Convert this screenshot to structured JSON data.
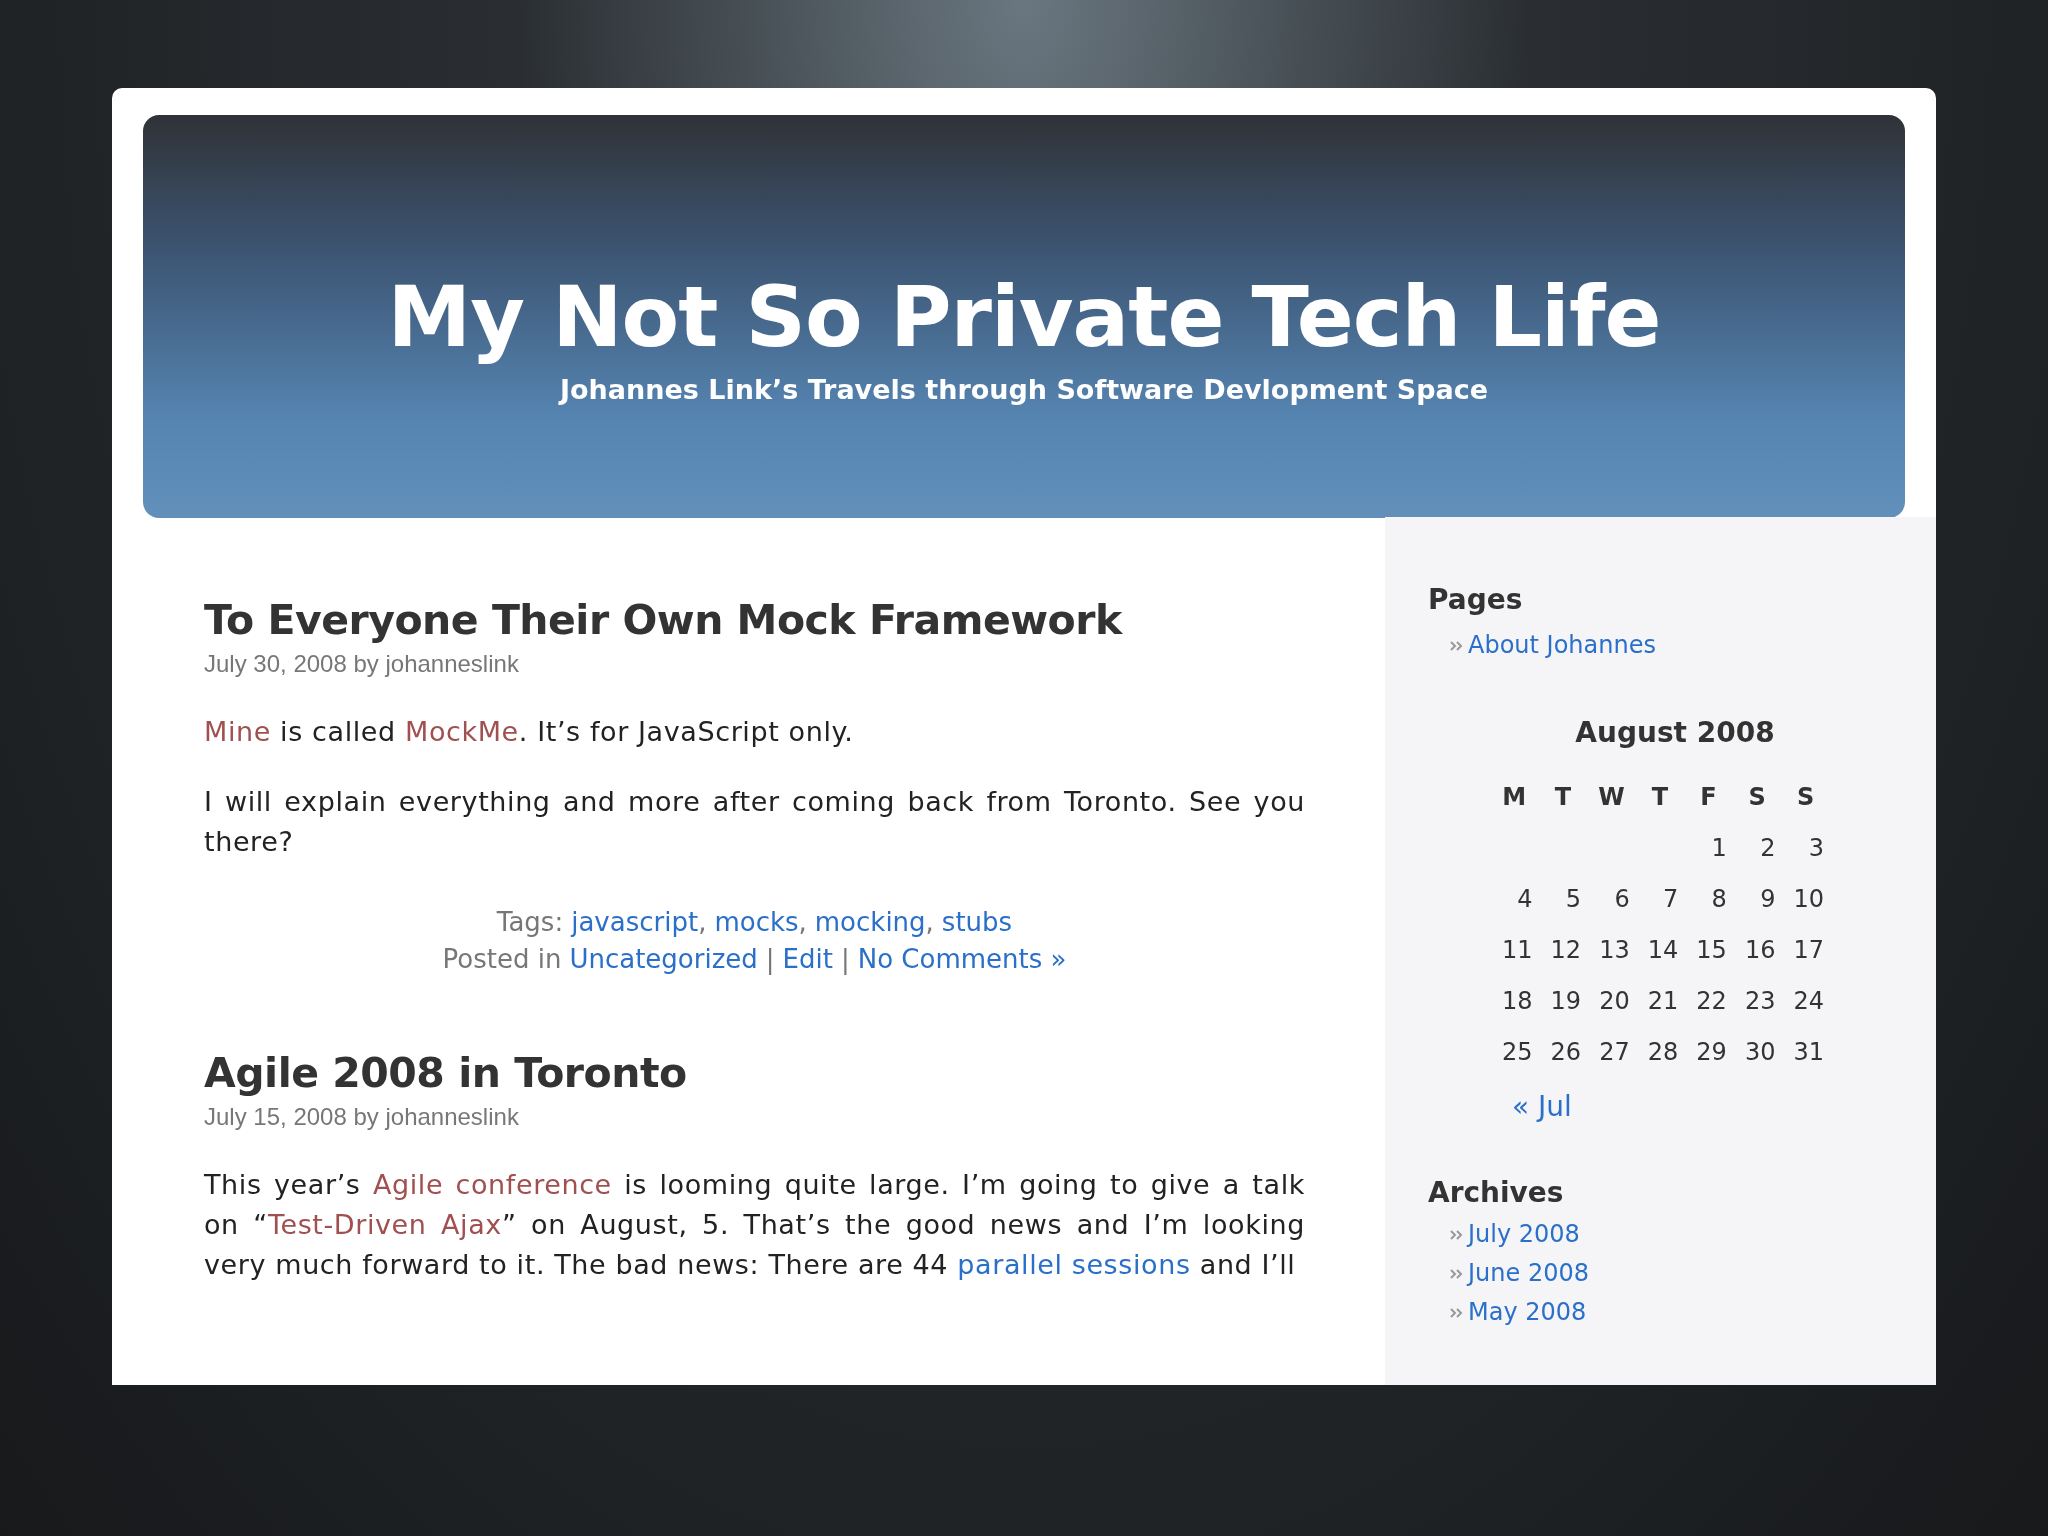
{
  "header": {
    "title": "My Not So Private Tech Life",
    "tagline": "Johannes Link’s Travels through Software Devlopment Space"
  },
  "posts": [
    {
      "title": "To Everyone Their Own Mock Framework",
      "meta": "July 30, 2008 by johanneslink",
      "paragraphs": [
        [
          {
            "kind": "visited",
            "text": "Mine"
          },
          {
            "kind": "text",
            "text": " is called "
          },
          {
            "kind": "visited",
            "text": "MockMe"
          },
          {
            "kind": "text",
            "text": ". It’s for JavaScript only."
          }
        ],
        [
          {
            "kind": "text",
            "text": "I will explain everything and more after coming back from Toronto. See you there?"
          }
        ]
      ],
      "tags_label": "Tags:",
      "tags": [
        "javascript",
        "mocks",
        "mocking",
        "stubs"
      ],
      "tag_separator": ",",
      "link_separator": "|",
      "posted_label": "Posted in",
      "category": "Uncategorized",
      "edit": "Edit",
      "comments": "No Comments »"
    },
    {
      "title": "Agile 2008 in Toronto",
      "meta": "July 15, 2008 by johanneslink",
      "paragraphs": [
        [
          {
            "kind": "text",
            "text": "This year’s "
          },
          {
            "kind": "visited",
            "text": "Agile conference"
          },
          {
            "kind": "text",
            "text": " is looming quite large. I’m going to give a talk on “"
          },
          {
            "kind": "visited",
            "text": "Test-Driven Ajax"
          },
          {
            "kind": "text",
            "text": "” on August, 5. That’s the good news and I’m looking very much forward to it. The bad news: There are 44 "
          },
          {
            "kind": "link",
            "text": "parallel sessions"
          },
          {
            "kind": "text",
            "text": " and I’ll"
          }
        ]
      ]
    }
  ],
  "sidebar": {
    "pages_title": "Pages",
    "pages": [
      "About Johannes"
    ],
    "calendar": {
      "title": "August 2008",
      "weekdays": [
        "M",
        "T",
        "W",
        "T",
        "F",
        "S",
        "S"
      ],
      "weeks": [
        [
          {
            "kind": "blank"
          },
          {
            "kind": "blank"
          },
          {
            "kind": "blank"
          },
          {
            "kind": "blank"
          },
          {
            "kind": "day",
            "day": "1"
          },
          {
            "kind": "day",
            "day": "2"
          },
          {
            "kind": "day",
            "day": "3"
          }
        ],
        [
          "4",
          "5",
          "6",
          "7",
          "8",
          "9",
          "10"
        ],
        [
          "11",
          "12",
          "13",
          "14",
          "15",
          "16",
          "17"
        ],
        [
          "18",
          "19",
          "20",
          "21",
          "22",
          "23",
          "24"
        ],
        [
          "25",
          "26",
          "27",
          "28",
          "29",
          "30",
          "31"
        ]
      ],
      "prev": "« Jul"
    },
    "archives_title": "Archives",
    "archives": [
      "July 2008",
      "June 2008",
      "May 2008"
    ]
  }
}
